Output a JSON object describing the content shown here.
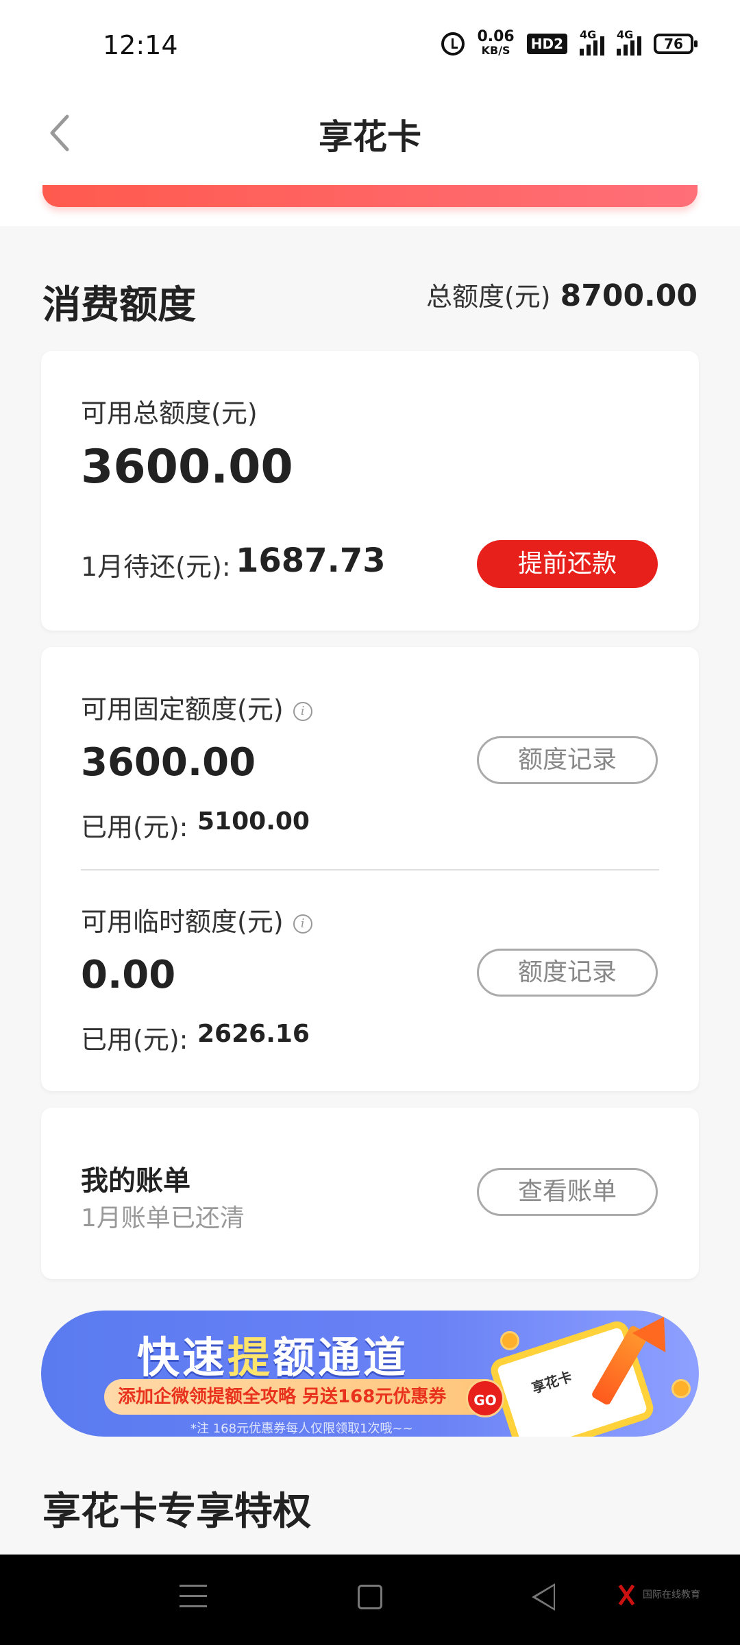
{
  "status_bar": {
    "time": "12:14",
    "speed_value": "0.06",
    "speed_unit": "KB/S",
    "hd_label": "HD2",
    "signal1_label": "4G",
    "signal2_label": "4G",
    "battery": "76"
  },
  "header": {
    "title": "享花卡"
  },
  "quota_section": {
    "title": "消费额度",
    "total_label": "总额度(元)",
    "total_value": "8700.00"
  },
  "summary_card": {
    "available_label": "可用总额度(元)",
    "available_value": "3600.00",
    "due_label": "1月待还(元):",
    "due_value": "1687.73",
    "repay_button": "提前还款"
  },
  "detail_card": {
    "fixed_label": "可用固定额度(元)",
    "fixed_value": "3600.00",
    "fixed_record_button": "额度记录",
    "fixed_used_label": "已用(元):",
    "fixed_used_value": "5100.00",
    "temp_label": "可用临时额度(元)",
    "temp_value": "0.00",
    "temp_record_button": "额度记录",
    "temp_used_label": "已用(元):",
    "temp_used_value": "2626.16",
    "info_icon_glyph": "i"
  },
  "bill_card": {
    "title": "我的账单",
    "subtitle": "1月账单已还清",
    "view_button": "查看账单"
  },
  "banner": {
    "title_part1": "快速",
    "title_highlight": "提",
    "title_part2": "额通道",
    "pill_text": "添加企微领提额全攻略 另送168元优惠券",
    "go_label": "GO",
    "note": "*注  168元优惠券每人仅限领取1次哦~~",
    "card_label": "享花卡"
  },
  "privileges_section": {
    "title": "享花卡专享特权"
  },
  "nav_bar": {
    "watermark_text": "国际在线教育"
  },
  "colors": {
    "brand_red": "#e8201b",
    "header_band": "#ff5a4e",
    "banner_blue": "#5a7bf0"
  },
  "icons": [
    "back-icon",
    "info-icon",
    "alarm-icon",
    "signal-icon",
    "battery-icon",
    "menu-icon",
    "home-icon",
    "nav-back-icon"
  ]
}
